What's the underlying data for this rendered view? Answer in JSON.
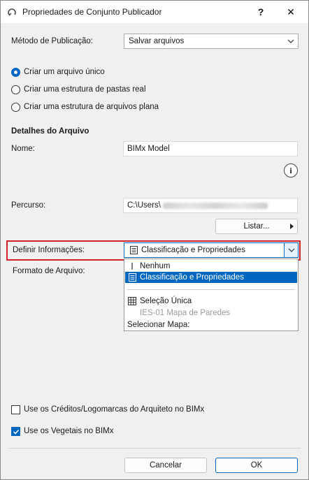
{
  "window": {
    "title": "Propriedades de Conjunto Publicador",
    "help": "?",
    "close": "✕"
  },
  "publish": {
    "method_label": "Método de Publicação:",
    "method_value": "Salvar arquivos"
  },
  "options": {
    "radio1": "Criar um arquivo único",
    "radio2": "Criar uma estrutura de pastas real",
    "radio3": "Criar uma estrutura de arquivos plana",
    "selected": "Criar um arquivo único"
  },
  "details": {
    "heading": "Detalhes do Arquivo",
    "name_label": "Nome:",
    "name_value": "BIMx Model",
    "info_symbol": "i",
    "path_label": "Percurso:",
    "path_value": "C:\\Users\\",
    "list_button": "Listar...",
    "define_label": "Definir Informações:",
    "define_value": "Classificação e Propriedades",
    "format_label": "Formato de Arquivo:"
  },
  "dropdown": {
    "item1": "Nenhum",
    "item2": "Classificação e Propriedades",
    "item3": "Seleção Única",
    "item4": "IES-01 Mapa de Paredes",
    "item5": "Selecionar Mapa:"
  },
  "checks": {
    "credits": "Use os Créditos/Logomarcas do Arquiteto no BIMx",
    "credits_checked": false,
    "vegetation": "Use os Vegetais no BIMx",
    "vegetation_checked": true
  },
  "footer": {
    "cancel": "Cancelar",
    "ok": "OK"
  },
  "colors": {
    "accent": "#0067c0",
    "highlight_border": "#d1212b"
  }
}
